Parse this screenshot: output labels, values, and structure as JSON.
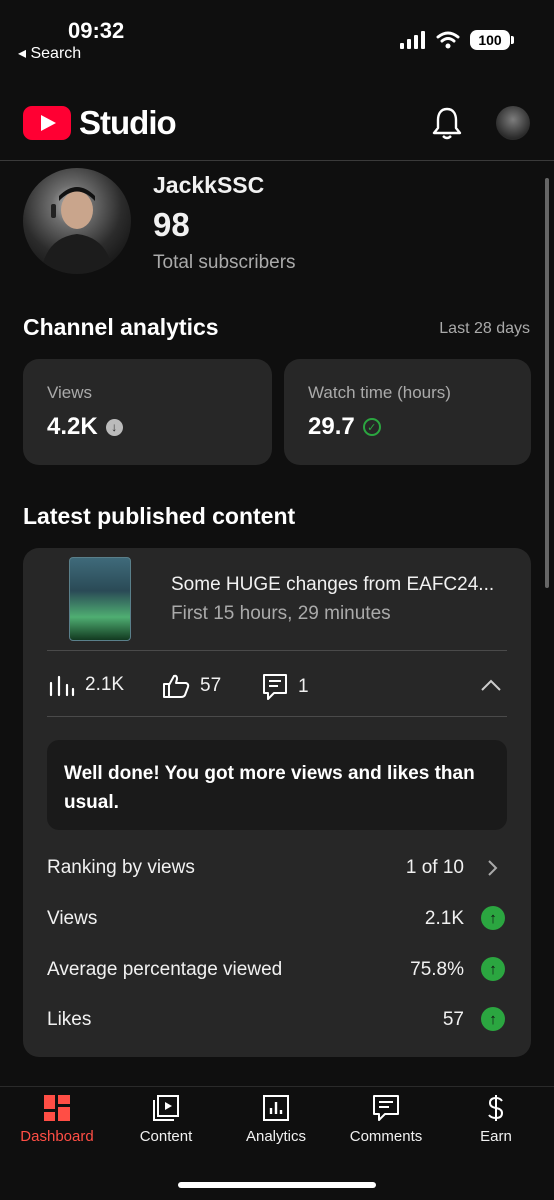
{
  "status_bar": {
    "time": "09:32",
    "back_label": "◂ Search",
    "battery": "100"
  },
  "header": {
    "app_name": "Studio",
    "brand_color": "#ff0033",
    "icons": [
      "notification-bell-icon",
      "account-avatar"
    ]
  },
  "channel": {
    "name": "JackkSSC",
    "subscriber_count": "98",
    "subscriber_label": "Total subscribers"
  },
  "analytics": {
    "title": "Channel analytics",
    "period": "Last 28 days",
    "metrics": [
      {
        "label": "Views",
        "value": "4.2K",
        "indicator": "down-arrow-icon"
      },
      {
        "label": "Watch time (hours)",
        "value": "29.7",
        "indicator": "check-icon"
      }
    ]
  },
  "latest": {
    "title": "Latest published content",
    "video_title": "Some HUGE changes from EAFC24...",
    "video_subtitle": "First 15 hours, 29 minutes",
    "stats": {
      "views": "2.1K",
      "likes": "57",
      "comments": "1"
    },
    "notice": "Well done! You got more views and likes than usual.",
    "rows": [
      {
        "label": "Ranking by views",
        "value": "1 of 10"
      },
      {
        "label": "Views",
        "value": "2.1K"
      },
      {
        "label": "Average percentage viewed",
        "value": "75.8%"
      },
      {
        "label": "Likes",
        "value": "57"
      }
    ],
    "positive_color": "#2ba640"
  },
  "bottom_nav": [
    {
      "label": "Dashboard",
      "active": true
    },
    {
      "label": "Content",
      "active": false
    },
    {
      "label": "Analytics",
      "active": false
    },
    {
      "label": "Comments",
      "active": false
    },
    {
      "label": "Earn",
      "active": false
    }
  ],
  "accent_active": "#ff4e45"
}
